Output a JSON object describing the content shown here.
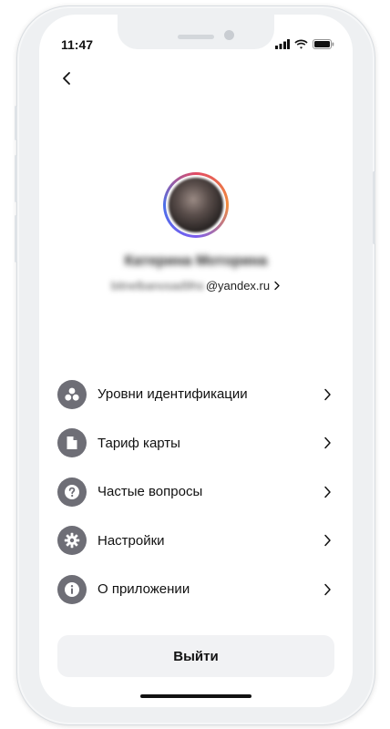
{
  "status_bar": {
    "time": "11:47"
  },
  "profile": {
    "name": "Катерина Моторина",
    "email_user": "bitnelbanosad9hs",
    "email_domain": "@yandex.ru"
  },
  "menu": {
    "items": [
      {
        "label": "Уровни идентификации",
        "icon": "users-icon"
      },
      {
        "label": "Тариф карты",
        "icon": "document-icon"
      },
      {
        "label": "Частые вопросы",
        "icon": "question-icon"
      },
      {
        "label": "Настройки",
        "icon": "gear-icon"
      },
      {
        "label": "О приложении",
        "icon": "info-icon"
      }
    ]
  },
  "logout": {
    "label": "Выйти"
  },
  "colors": {
    "icon_bg": "#6e6e76",
    "button_bg": "#f1f2f4",
    "ring_accent": "#7a5cf0"
  }
}
